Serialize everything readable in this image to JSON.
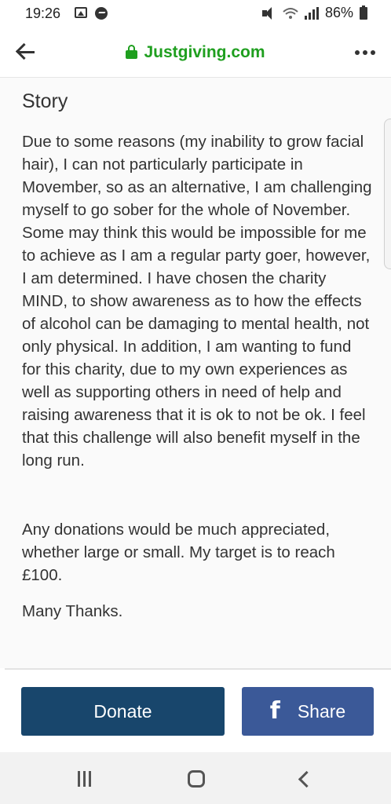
{
  "status_bar": {
    "time": "19:26",
    "battery": "86%",
    "icons": [
      "gallery-icon",
      "messenger-icon",
      "mute-icon",
      "wifi-icon",
      "signal-icon",
      "battery-icon"
    ]
  },
  "browser": {
    "url": "Justgiving.com",
    "secure": true,
    "icons": [
      "back-arrow-icon",
      "lock-icon",
      "more-options-icon"
    ]
  },
  "story": {
    "heading": "Story",
    "paragraphs": [
      "Due to some reasons (my inability to grow facial hair), I can not particularly participate in Movember, so as an alternative, I am challenging myself to go sober for the whole of November. Some may think this would be impossible for me to achieve as I am a regular party goer, however, I am determined. I have chosen the charity MIND, to show awareness as to how the effects of alcohol can be damaging to mental health, not only physical. In addition, I am wanting to fund for this charity, due to my own experiences as well as supporting others in need of help and raising awareness that it is ok to not be ok. I feel that this challenge will also benefit myself in the long run.",
      "Any donations would be much appreciated, whether large or small. My target is to reach £100.",
      "Many Thanks."
    ]
  },
  "actions": {
    "donate_label": "Donate",
    "share_label": "Share",
    "share_icon": "facebook-icon",
    "donate_color": "#18466c",
    "share_color": "#3b5998"
  },
  "colors": {
    "url_green": "#1f9f1f",
    "text": "#333333"
  },
  "nav": {
    "icons": [
      "recents-icon",
      "home-icon",
      "back-icon"
    ]
  }
}
